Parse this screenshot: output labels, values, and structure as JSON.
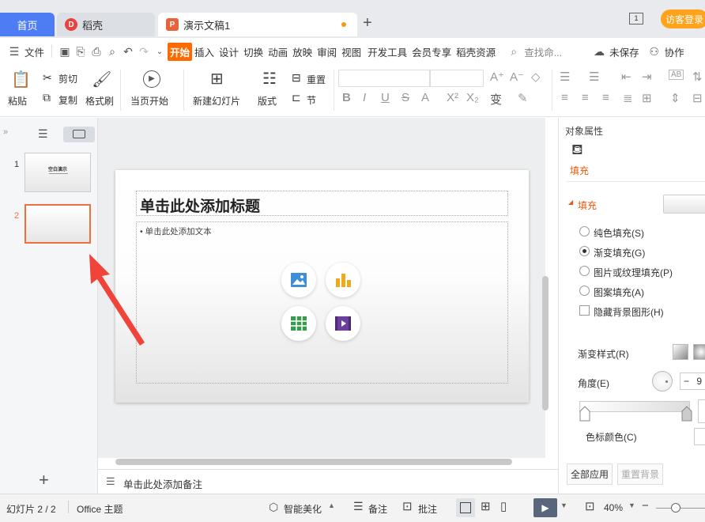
{
  "tabs": {
    "home": "首页",
    "daoke": "稻壳",
    "doc": "演示文稿1",
    "visitor": "访客登录"
  },
  "menu": {
    "file": "文件",
    "items": [
      "开始",
      "插入",
      "设计",
      "切换",
      "动画",
      "放映",
      "审阅",
      "视图",
      "开发工具",
      "会员专享",
      "稻壳资源"
    ],
    "search": "查找命...",
    "unsaved": "未保存",
    "collab": "协作"
  },
  "ribbon": {
    "paste": "粘贴",
    "cut": "剪切",
    "copy": "复制",
    "format_painter": "格式刷",
    "from_current": "当页开始",
    "new_slide": "新建幻灯片",
    "layout": "版式",
    "reset": "重置",
    "section": "节"
  },
  "sidebar": {
    "slide1_num": "1",
    "slide2_num": "2",
    "slide1_title": "空白演示"
  },
  "slide": {
    "title_placeholder": "单击此处添加标题",
    "body_placeholder": "• 单击此处添加文本"
  },
  "notes": {
    "placeholder": "单击此处添加备注"
  },
  "props": {
    "header": "对象属性",
    "tab_fill": "填充",
    "section_fill": "填充",
    "options": [
      "纯色填充(S)",
      "渐变填充(G)",
      "图片或纹理填充(P)",
      "图案填充(A)"
    ],
    "selected_option": 1,
    "hide_bg": "隐藏背景图形(H)",
    "gradient_style": "渐变样式(R)",
    "angle": "角度(E)",
    "angle_value": "9",
    "stop_color": "色标颜色(C)",
    "apply_all": "全部应用",
    "reset_bg": "重置背景"
  },
  "status": {
    "slide_counter": "幻灯片 2 / 2",
    "theme": "Office 主题",
    "smart_beautify": "智能美化",
    "notes": "备注",
    "comments": "批注",
    "zoom": "40%"
  },
  "colors": {
    "accent": "#4d7cf5",
    "active_menu": "#ff6a00",
    "selected_thumb": "#f0703b",
    "arrow": "#f0433a",
    "fill_header": "#e8590c"
  }
}
